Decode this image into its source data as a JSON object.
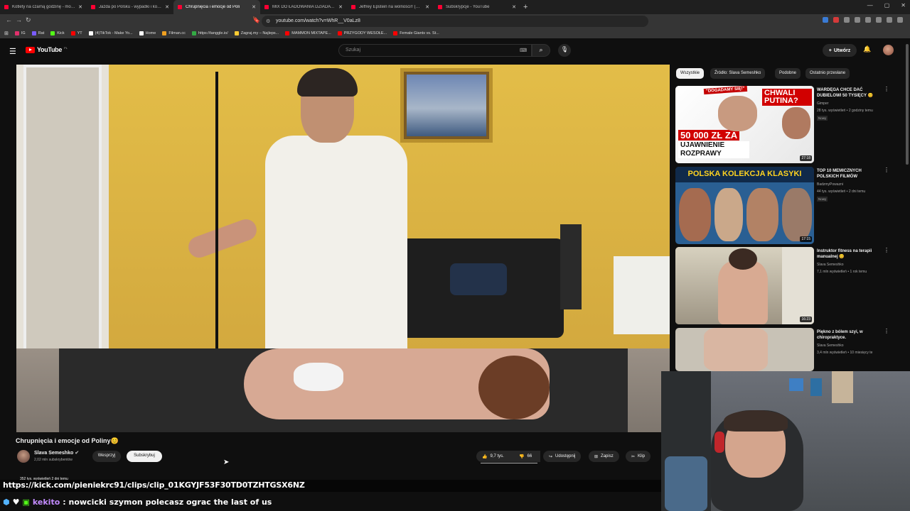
{
  "browser": {
    "tabs": [
      {
        "label": "Kotlety na czarną godzinę - mogą st"
      },
      {
        "label": "Jazda po Polsku - wypadki i kolizje o"
      },
      {
        "label": "Chrupnięcia i emocje od Poli",
        "active": true
      },
      {
        "label": "MIX DO ŁADOWANIA DZIADA W PA"
      },
      {
        "label": "Jeffrey Epstein na wolności!! (Zobrc"
      },
      {
        "label": "Subskrypcje - YouTube"
      }
    ],
    "new_tab": "+",
    "url": "youtube.com/watch?v=WhR__V0aLz8",
    "bookmarks": [
      {
        "label": "IG",
        "color": "#e1306c"
      },
      {
        "label": "Rat",
        "color": "#7a5cff"
      },
      {
        "label": "Kick",
        "color": "#53fc18"
      },
      {
        "label": "YT",
        "color": "#ff0000"
      },
      {
        "label": "(4)TikTok - Make Yo...",
        "color": "#ffffff"
      },
      {
        "label": "Home",
        "color": "#ffffff"
      },
      {
        "label": "Filman.cc",
        "color": "#f0a020"
      },
      {
        "label": "https://tanggle.io/",
        "color": "#33aa44"
      },
      {
        "label": "Zagraj.my – Najleps...",
        "color": "#ffcc33"
      },
      {
        "label": "MAMMON MIXTAPE...",
        "color": "#ff0000"
      },
      {
        "label": "PRZYGODY WESOŁE...",
        "color": "#ff0000"
      },
      {
        "label": "Female Giants vs. St...",
        "color": "#ff0000"
      }
    ]
  },
  "youtube": {
    "logo": "YouTube",
    "logo_country": "PL",
    "search_placeholder": "Szukaj",
    "create_label": "Utwórz",
    "video_title": "Chrupnięcia i emocje od Poliny😊",
    "channel_name": "Slava Semeshko",
    "channel_subs": "2,02 mln subskrybentów",
    "support_label": "Wesprzyj",
    "subscribe_label": "Subskrybuj",
    "likes": "9,7 tys.",
    "dislikes": "66",
    "share_label": "Udostępnij",
    "save_label": "Zapisz",
    "clip_label": "Klip",
    "desc_meta": "352 tys. wyświetleń  2 dni temu",
    "chips": [
      {
        "label": "Wszystkie",
        "selected": true
      },
      {
        "label": "Źródło: Slava Semeshko"
      },
      {
        "label": "Podobne"
      },
      {
        "label": "Ostatnio przesłane"
      }
    ],
    "recs": [
      {
        "title": "WARDĘGA CHCE DAĆ DUBIELOWI 50 TYSIĘCY 😊",
        "channel": "Gimper",
        "meta": "28 tys. wyświetleń • 2 godziny temu",
        "badge": "Nowy",
        "duration": "27:18",
        "thumb_text_a": "\"DOGADAMY SIĘ!\"",
        "thumb_text_b": "CHWALI PUTINA?",
        "thumb_text_c": "50 000 ZŁ ZA",
        "thumb_text_d": "UJAWNIENIE ROZPRAWY"
      },
      {
        "title": "TOP 10 MEMICZNYCH POLSKICH FILMÓW",
        "channel": "BadzmyPowazni",
        "meta": "44 tys. wyświetleń • 2 dni temu",
        "badge": "Nowy",
        "duration": "17:15",
        "thumb_text_a": "POLSKA KOLEKCJA KLASYKI"
      },
      {
        "title": "Instruktor fitness na terapii manualnej 😊",
        "channel": "Slava Semeshko",
        "meta": "7,1 mln wyświetleń • 1 rok temu",
        "duration": "16:23"
      },
      {
        "title": "Piękno z bólem szyi, w chiropraktyce.",
        "channel": "Slava Semeshko",
        "meta": "3,4 mln wyświetleń • 10 miesięcy te"
      }
    ]
  },
  "overlay": {
    "clip_url": "https://kick.com/pieniekrc91/clips/clip_01KGYJF53F30TD0TZHTGSX6NZ",
    "chat_user": "kekito",
    "chat_message": ": nowcicki szymon polecasz ograc the last of us"
  }
}
